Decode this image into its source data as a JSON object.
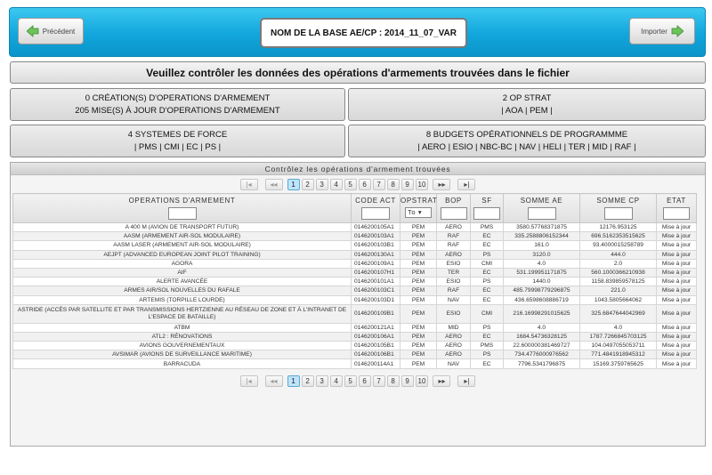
{
  "header": {
    "prev_label": "Précédent",
    "title": "NOM DE LA BASE AE/CP : 2014_11_07_VAR",
    "next_label": "Importer"
  },
  "banner": "Veuillez contrôler les données des opérations d'armements trouvées dans le fichier",
  "panels": {
    "ops_line1": "0 CRÉATION(S) D'OPERATIONS D'ARMEMENT",
    "ops_line2": "205 MISE(S) À JOUR D'OPERATIONS D'ARMEMENT",
    "strat_title": "2 OP STRAT",
    "strat_list": "| AOA | PEM |",
    "sys_title": "4 SYSTEMES DE FORCE",
    "sys_list": "| PMS | CMI | EC | PS |",
    "bop_title": "8 BUDGETS OPÉRATIONNELS DE PROGRAMMME",
    "bop_list": "| AERO | ESIO | NBC-BC | NAV | HELI | TER | MID | RAF |"
  },
  "grid": {
    "caption": "Contrôlez les opérations d'armement trouvées",
    "pager": {
      "first": "|◂",
      "prev": "◂◂",
      "pages": [
        "1",
        "2",
        "3",
        "4",
        "5",
        "6",
        "7",
        "8",
        "9",
        "10"
      ],
      "current": "1",
      "next": "▸▸",
      "last": "▸|"
    },
    "columns": [
      "OPERATIONS D'ARMEMENT",
      "CODE ACT",
      "OPSTRAT",
      "BOP",
      "SF",
      "SOMME AE",
      "SOMME CP",
      "ETAT"
    ],
    "opstrat_filter": "To",
    "rows": [
      [
        "A 400 M (AVION DE TRANSPORT FUTUR)",
        "0146200105A1",
        "PEM",
        "AERO",
        "PMS",
        "3580.57768371875",
        "12176.953125",
        "Mise à jour"
      ],
      [
        "AASM (ARMEMENT AIR-SOL MODULAIRE)",
        "0146200103A1",
        "PEM",
        "RAF",
        "EC",
        "335.2588806152344",
        "696.5162353515625",
        "Mise à jour"
      ],
      [
        "AASM LASER (ARMEMENT AIR-SOL MODULAIRE)",
        "0146200103B1",
        "PEM",
        "RAF",
        "EC",
        "161.0",
        "93.4000015258789",
        "Mise à jour"
      ],
      [
        "AEJPT (ADVANCED EUROPEAN JOINT PILOT TRAINING)",
        "0146200130A1",
        "PEM",
        "AERO",
        "PS",
        "3120.0",
        "444.0",
        "Mise à jour"
      ],
      [
        "AGORA",
        "0146200109A1",
        "PEM",
        "ESIO",
        "CMI",
        "4.0",
        "2.0",
        "Mise à jour"
      ],
      [
        "AIF",
        "0146200107H1",
        "PEM",
        "TER",
        "EC",
        "531.199951171875",
        "560.1000366210938",
        "Mise à jour"
      ],
      [
        "ALERTE AVANCÉE",
        "0146200101A1",
        "PEM",
        "ESIO",
        "PS",
        "1440.0",
        "1158.839859578125",
        "Mise à jour"
      ],
      [
        "ARMES AIR/SOL NOUVELLES DU RAFALE",
        "0146200103C1",
        "PEM",
        "RAF",
        "EC",
        "485.79998779296875",
        "221.0",
        "Mise à jour"
      ],
      [
        "ARTEMIS (TORPILLE LOURDE)",
        "0146200103D1",
        "PEM",
        "NAV",
        "EC",
        "436.6598608886719",
        "1043.5805664062",
        "Mise à jour"
      ],
      [
        "ASTRIDE (ACCÈS PAR SATELLITE ET PAR TRANSMISSIONS HERTZIENNE AU RÉSEAU DE ZONE ET À L'INTRANET DE L'ESPACE DE BATAILLE)",
        "0146200109B1",
        "PEM",
        "ESIO",
        "CMI",
        "216.16998291015625",
        "325.6847644042969",
        "Mise à jour"
      ],
      [
        "ATBM",
        "0146200121A1",
        "PEM",
        "MID",
        "PS",
        "4.0",
        "4.0",
        "Mise à jour"
      ],
      [
        "ATL2 : RÉNOVATIONS",
        "0146200106A1",
        "PEM",
        "AERO",
        "EC",
        "1684.54736328125",
        "1787.7266845703125",
        "Mise à jour"
      ],
      [
        "AVIONS GOUVERNEMENTAUX",
        "0146200105B1",
        "PEM",
        "AERO",
        "PMS",
        "22.600000381469727",
        "104.0497055053711",
        "Mise à jour"
      ],
      [
        "AVSIMAR (AVIONS DE SURVEILLANCE MARITIME)",
        "0146200106B1",
        "PEM",
        "AERO",
        "PS",
        "734.4776000976562",
        "771.4841918945312",
        "Mise à jour"
      ],
      [
        "BARRACUDA",
        "0146200114A1",
        "PEM",
        "NAV",
        "EC",
        "7796.5341796875",
        "15169.3759765625",
        "Mise à jour"
      ]
    ]
  },
  "colors": {
    "header_gradient_top": "#3cc8f0",
    "header_gradient_bottom": "#0b94c9",
    "arrow_green": "#5cb85c",
    "current_page": "#bfe4f6"
  }
}
